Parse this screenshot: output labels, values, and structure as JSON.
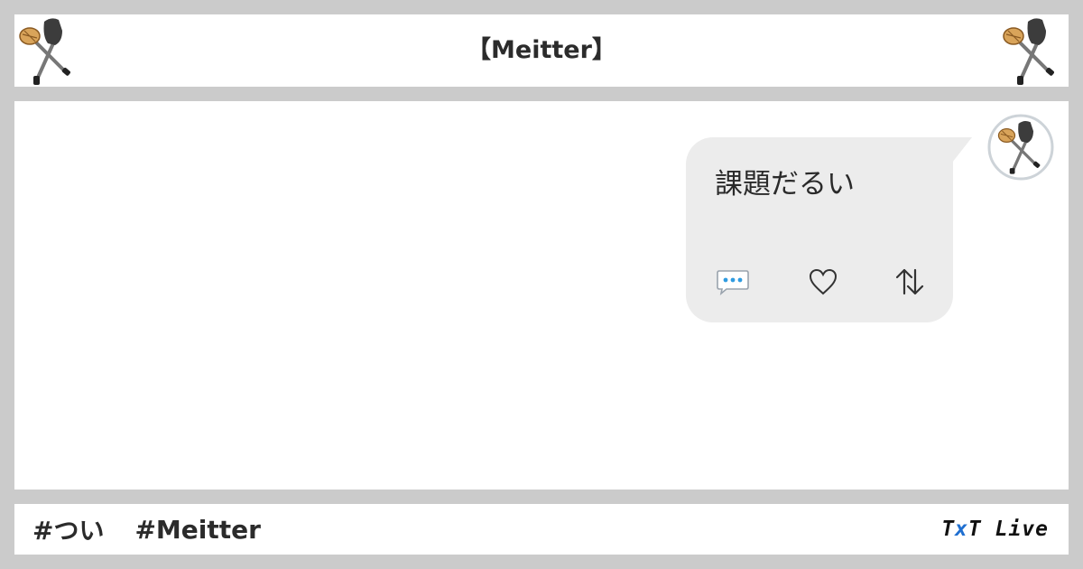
{
  "header": {
    "title": "【Meitter】",
    "logo_icon": "character-with-crossed-tools-icon"
  },
  "post": {
    "text": "課題だるい",
    "avatar_icon": "character-with-crossed-tools-icon",
    "actions": [
      {
        "name": "reply",
        "icon": "speech-bubble-icon"
      },
      {
        "name": "like",
        "icon": "heart-outline-icon",
        "glyph": "♡"
      },
      {
        "name": "share",
        "icon": "up-down-arrows-icon",
        "glyph": "⇅"
      }
    ]
  },
  "footer": {
    "hashtags": [
      "#つい",
      "#Meitter"
    ],
    "brand": {
      "part1": "T",
      "part2": "x",
      "part3": "T Live"
    }
  },
  "colors": {
    "background": "#cbcbcb",
    "panel": "#ffffff",
    "bubble": "#ececec",
    "brand_accent": "#1f6fd0",
    "reply_dots": "#2f9be0"
  }
}
